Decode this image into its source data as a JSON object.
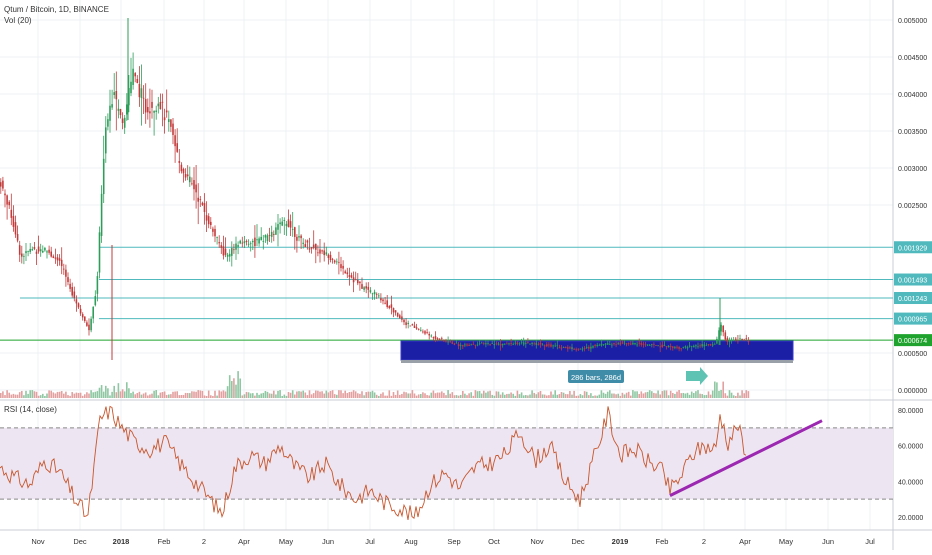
{
  "header": {
    "symbol_line": "Qtum / Bitcoin, 1D, BINANCE",
    "volume_line": "Vol (20)",
    "rsi_line": "RSI (14, close)"
  },
  "chart_data": [
    {
      "type": "candlestick",
      "title": "Qtum / Bitcoin, 1D, BINANCE",
      "yaxis": {
        "ticks": [
          {
            "label": "0.005000",
            "value": 0.005
          },
          {
            "label": "0.004500",
            "value": 0.0045
          },
          {
            "label": "0.004000",
            "value": 0.004
          },
          {
            "label": "0.003500",
            "value": 0.0035
          },
          {
            "label": "0.003000",
            "value": 0.003
          },
          {
            "label": "0.002500",
            "value": 0.0025
          },
          {
            "label": "0.000500",
            "value": 0.0005
          },
          {
            "label": "0.000000",
            "value": 0.0
          }
        ]
      },
      "xaxis": {
        "ticks": [
          "Nov",
          "Dec",
          "2018",
          "Feb",
          "2",
          "Apr",
          "May",
          "Jun",
          "Jul",
          "Aug",
          "Sep",
          "Oct",
          "Nov",
          "Dec",
          "2019",
          "Feb",
          "2",
          "Apr",
          "May",
          "Jun",
          "Jul"
        ]
      },
      "horizontal_levels": [
        {
          "label": "0.001929",
          "value": 0.001929,
          "color": "#4fb9bd"
        },
        {
          "label": "0.001493",
          "value": 0.001493,
          "color": "#4fb9bd"
        },
        {
          "label": "0.001243",
          "value": 0.001243,
          "color": "#4fb9bd"
        },
        {
          "label": "0.000965",
          "value": 0.000965,
          "color": "#4fb9bd"
        },
        {
          "label": "0.000674",
          "value": 0.000674,
          "color": "#1fa32e"
        }
      ],
      "approx_close_path": [
        [
          0,
          0.0028
        ],
        [
          10,
          0.0024
        ],
        [
          20,
          0.0018
        ],
        [
          30,
          0.0019
        ],
        [
          45,
          0.0019
        ],
        [
          60,
          0.0017
        ],
        [
          75,
          0.0012
        ],
        [
          88,
          0.0008
        ],
        [
          96,
          0.0014
        ],
        [
          104,
          0.0035
        ],
        [
          112,
          0.004
        ],
        [
          122,
          0.0036
        ],
        [
          132,
          0.0043
        ],
        [
          145,
          0.0038
        ],
        [
          158,
          0.0039
        ],
        [
          168,
          0.0036
        ],
        [
          180,
          0.003
        ],
        [
          195,
          0.0027
        ],
        [
          210,
          0.0022
        ],
        [
          225,
          0.0018
        ],
        [
          240,
          0.002
        ],
        [
          255,
          0.002
        ],
        [
          270,
          0.0021
        ],
        [
          285,
          0.0023
        ],
        [
          300,
          0.002
        ],
        [
          315,
          0.0019
        ],
        [
          330,
          0.0018
        ],
        [
          345,
          0.0016
        ],
        [
          360,
          0.0014
        ],
        [
          375,
          0.0013
        ],
        [
          390,
          0.0011
        ],
        [
          405,
          0.0009
        ],
        [
          420,
          0.0008
        ],
        [
          435,
          0.0007
        ],
        [
          460,
          0.0006
        ],
        [
          480,
          0.00063
        ],
        [
          500,
          0.00062
        ],
        [
          520,
          0.00063
        ],
        [
          540,
          0.00062
        ],
        [
          560,
          0.00058
        ],
        [
          580,
          0.00055
        ],
        [
          600,
          0.00062
        ],
        [
          620,
          0.00063
        ],
        [
          640,
          0.00062
        ],
        [
          660,
          0.0006
        ],
        [
          680,
          0.00057
        ],
        [
          700,
          0.0006
        ],
        [
          715,
          0.00062
        ],
        [
          720,
          0.0009
        ],
        [
          725,
          0.00066
        ],
        [
          740,
          0.00069
        ],
        [
          748,
          0.00067
        ]
      ],
      "annotations": [
        {
          "text": "286 bars, 286d",
          "kind": "date-range"
        }
      ]
    },
    {
      "type": "line",
      "title": "RSI (14, close)",
      "ylim": [
        15,
        85
      ],
      "yaxis": {
        "ticks": [
          {
            "label": "80.0000",
            "value": 80
          },
          {
            "label": "60.0000",
            "value": 60
          },
          {
            "label": "40.0000",
            "value": 40
          },
          {
            "label": "20.0000",
            "value": 20
          }
        ]
      },
      "band": [
        30,
        70
      ],
      "approx_values": [
        [
          0,
          48
        ],
        [
          15,
          42
        ],
        [
          30,
          38
        ],
        [
          45,
          52
        ],
        [
          60,
          45
        ],
        [
          75,
          30
        ],
        [
          88,
          20
        ],
        [
          100,
          75
        ],
        [
          110,
          80
        ],
        [
          122,
          70
        ],
        [
          135,
          62
        ],
        [
          150,
          58
        ],
        [
          165,
          62
        ],
        [
          180,
          50
        ],
        [
          195,
          40
        ],
        [
          210,
          30
        ],
        [
          222,
          22
        ],
        [
          235,
          48
        ],
        [
          250,
          55
        ],
        [
          265,
          50
        ],
        [
          280,
          60
        ],
        [
          295,
          48
        ],
        [
          310,
          42
        ],
        [
          325,
          50
        ],
        [
          340,
          38
        ],
        [
          355,
          30
        ],
        [
          370,
          35
        ],
        [
          385,
          28
        ],
        [
          400,
          25
        ],
        [
          415,
          20
        ],
        [
          430,
          38
        ],
        [
          445,
          45
        ],
        [
          460,
          36
        ],
        [
          475,
          48
        ],
        [
          490,
          50
        ],
        [
          505,
          55
        ],
        [
          520,
          68
        ],
        [
          535,
          52
        ],
        [
          550,
          60
        ],
        [
          565,
          40
        ],
        [
          580,
          30
        ],
        [
          595,
          55
        ],
        [
          608,
          78
        ],
        [
          620,
          55
        ],
        [
          635,
          58
        ],
        [
          650,
          50
        ],
        [
          660,
          48
        ],
        [
          670,
          35
        ],
        [
          680,
          42
        ],
        [
          692,
          55
        ],
        [
          704,
          60
        ],
        [
          716,
          58
        ],
        [
          720,
          78
        ],
        [
          728,
          62
        ],
        [
          738,
          72
        ],
        [
          746,
          52
        ]
      ],
      "trendline": {
        "from": [
          670,
          32
        ],
        "to": [
          822,
          74
        ],
        "color": "#9c27b0"
      }
    }
  ]
}
